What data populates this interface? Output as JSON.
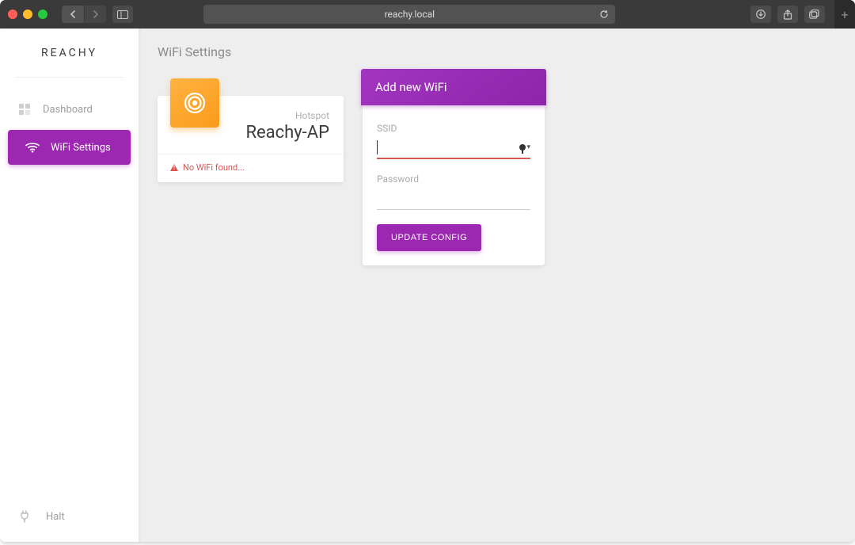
{
  "browser": {
    "url_display": "reachy.local"
  },
  "sidebar": {
    "brand": "REACHY",
    "items": [
      {
        "label": "Dashboard",
        "active": false
      },
      {
        "label": "WiFi Settings",
        "active": true
      }
    ],
    "halt_label": "Halt"
  },
  "page": {
    "title": "WiFi Settings"
  },
  "status_card": {
    "subtitle": "Hotspot",
    "value": "Reachy-AP",
    "warning": "No WiFi found..."
  },
  "form_card": {
    "title": "Add new WiFi",
    "ssid_label": "SSID",
    "ssid_value": "",
    "password_label": "Password",
    "password_value": "",
    "submit_label": "UPDATE CONFIG"
  }
}
